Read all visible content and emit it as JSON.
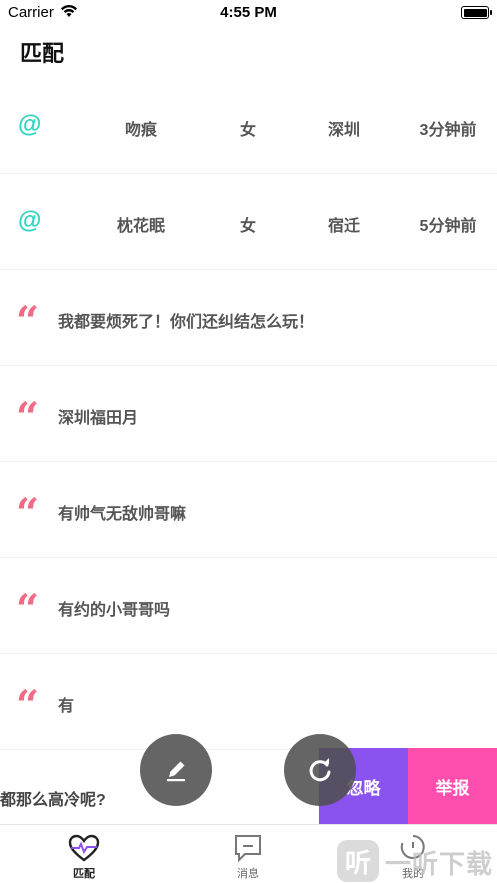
{
  "status_bar": {
    "carrier": "Carrier",
    "time": "4:55 PM"
  },
  "page_title": "匹配",
  "match_rows": [
    {
      "name": "吻痕",
      "gender": "女",
      "city": "深圳",
      "time": "3分钟前"
    },
    {
      "name": "枕花眠",
      "gender": "女",
      "city": "宿迁",
      "time": "5分钟前"
    }
  ],
  "messages": [
    "我都要烦死了！你们还纠结怎么玩！",
    "深圳福田月",
    "有帅气无敌帅哥嘛",
    "有约的小哥哥吗",
    "有"
  ],
  "swiped_row": {
    "text": "都那么高冷呢?",
    "ignore_label": "忽略",
    "report_label": "举报"
  },
  "tabs": [
    {
      "label": "匹配",
      "icon": "heart-pulse-icon",
      "active": true
    },
    {
      "label": "消息",
      "icon": "message-icon",
      "active": false
    },
    {
      "label": "我的",
      "icon": "profile-icon",
      "active": false
    }
  ],
  "fabs": {
    "edit": "pencil-icon",
    "refresh": "refresh-icon"
  },
  "watermark": {
    "badge": "听",
    "text": "一听下载"
  },
  "colors": {
    "at_icon": "#2fd4c0",
    "quote_icon": "#f06b86",
    "ignore": "#8a53f0",
    "report": "#ff4fae"
  }
}
